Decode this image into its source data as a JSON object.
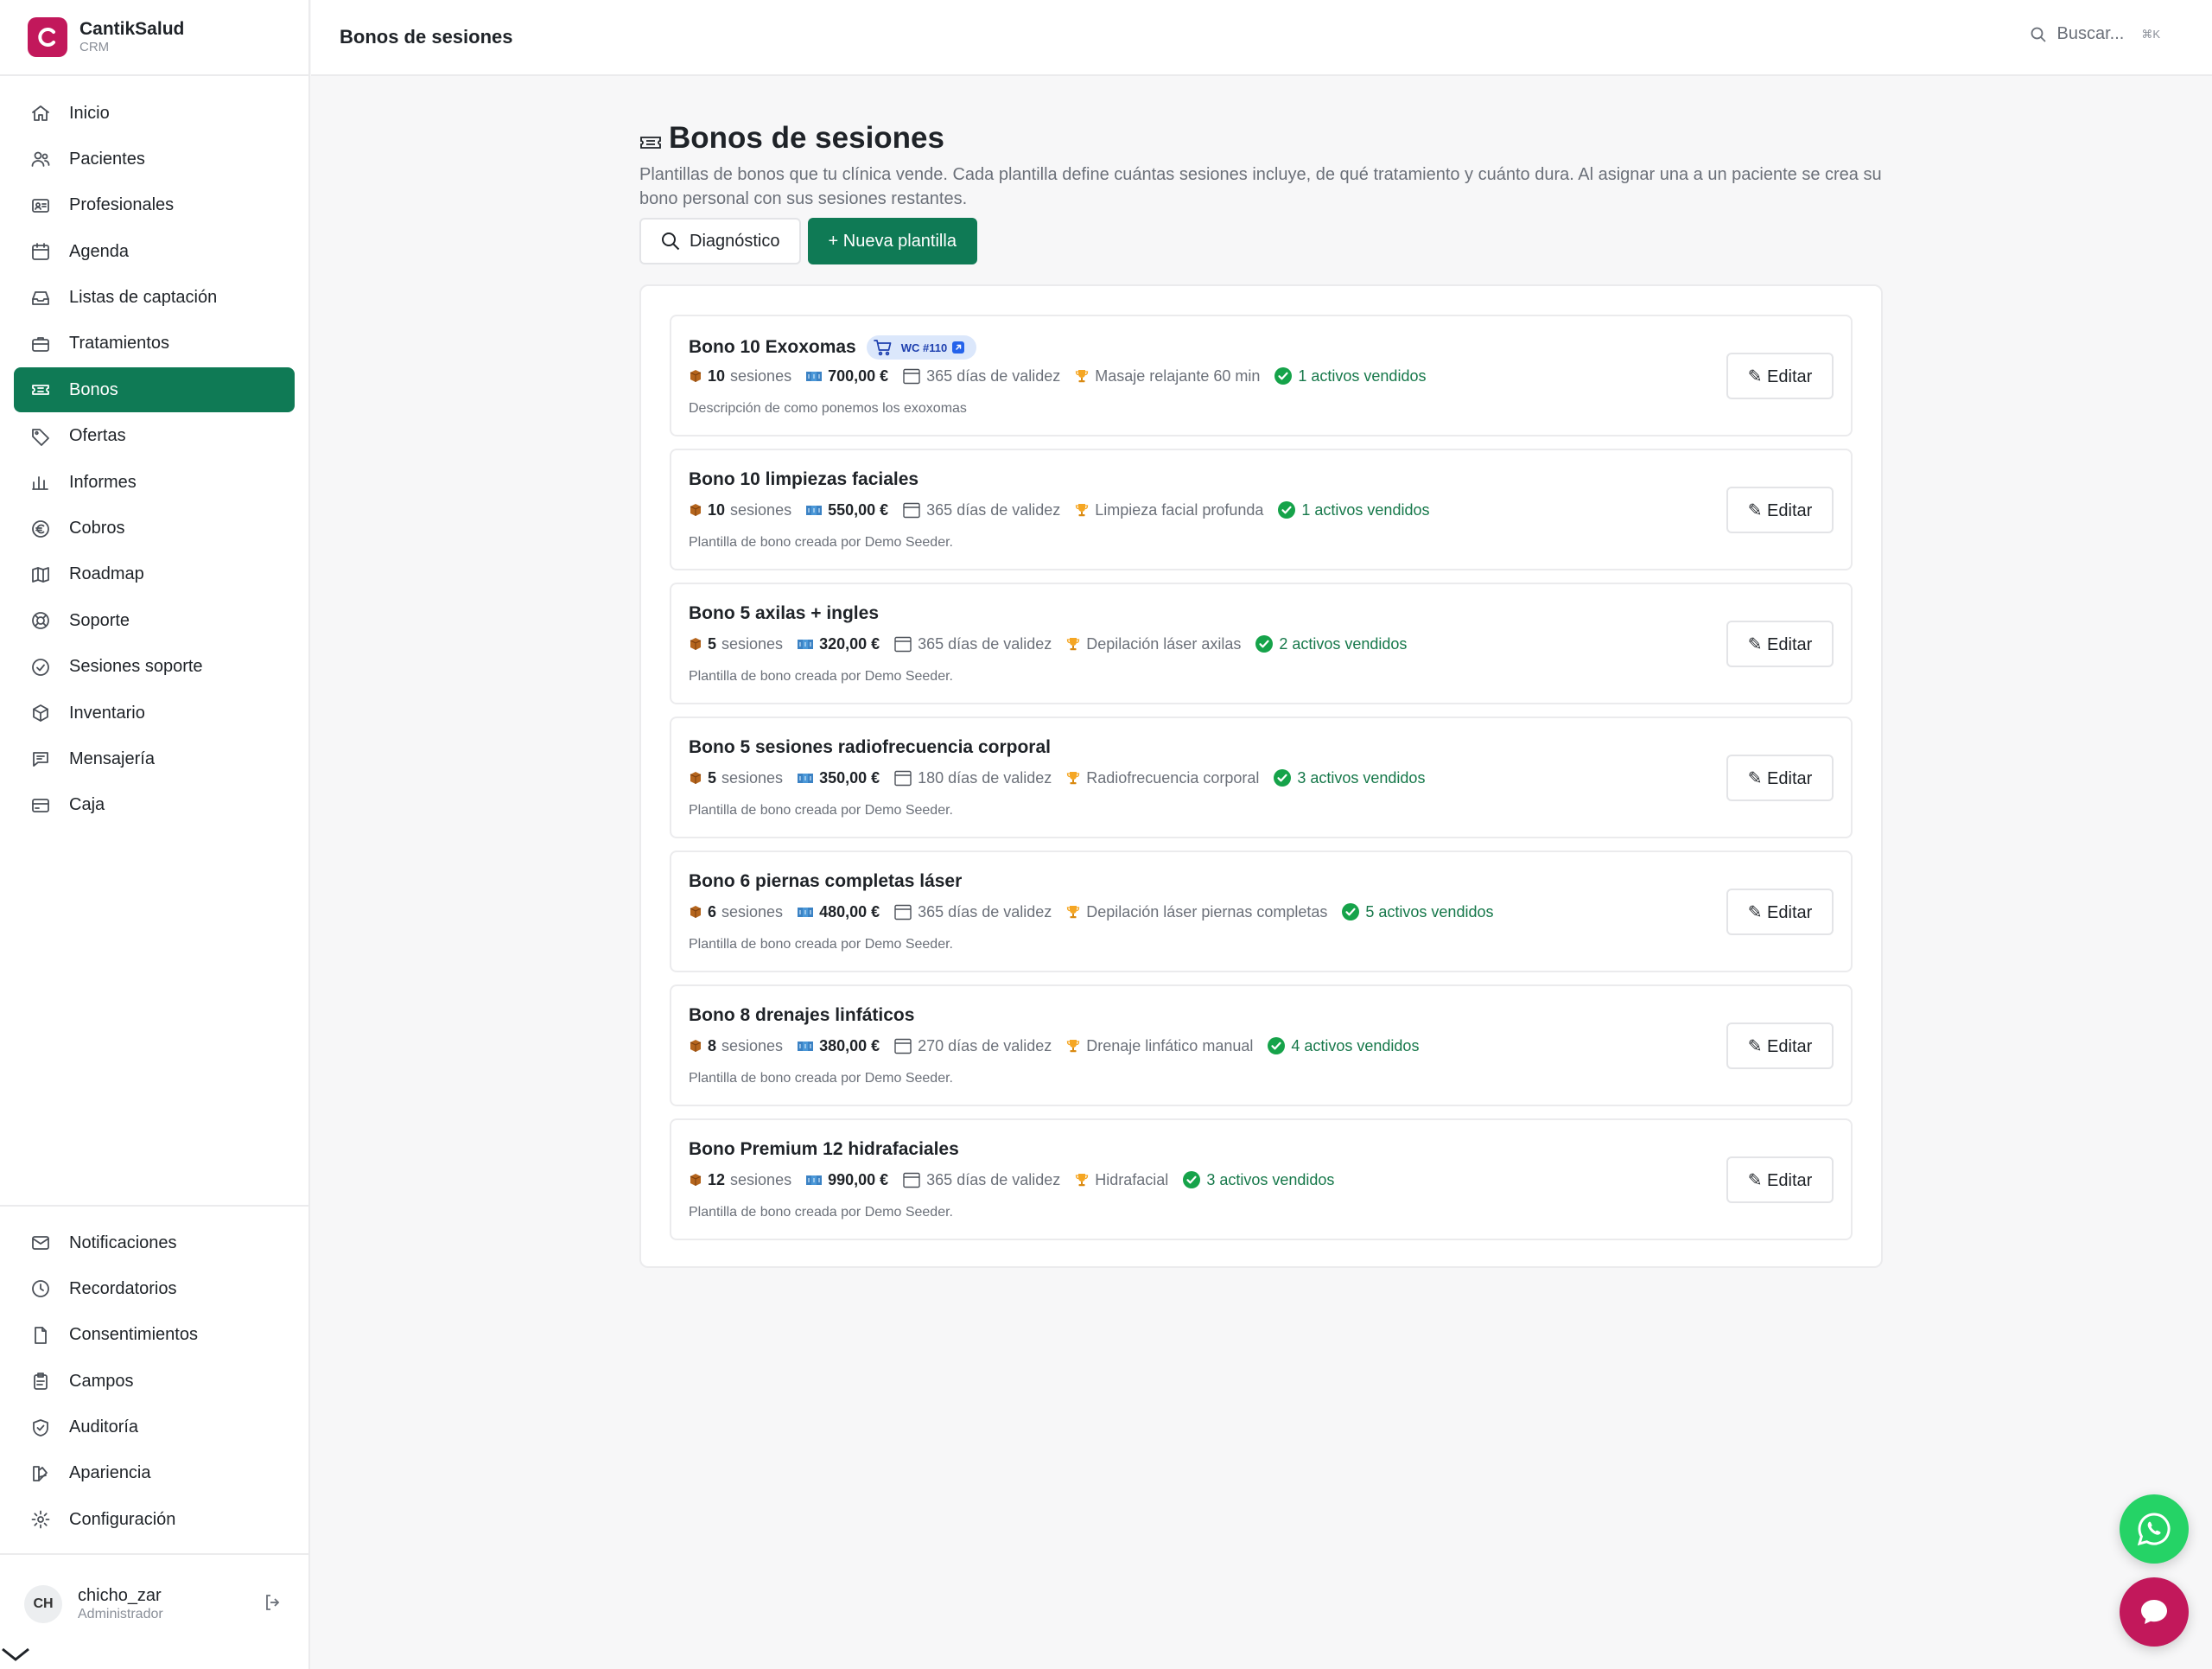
{
  "brand": {
    "name": "CantikSalud",
    "sub": "CRM"
  },
  "nav": [
    {
      "label": "Inicio",
      "icon": "home-icon"
    },
    {
      "label": "Pacientes",
      "icon": "users-icon"
    },
    {
      "label": "Profesionales",
      "icon": "id-card-icon"
    },
    {
      "label": "Agenda",
      "icon": "calendar-icon"
    },
    {
      "label": "Listas de captación",
      "icon": "inbox-icon"
    },
    {
      "label": "Tratamientos",
      "icon": "briefcase-icon"
    },
    {
      "label": "Bonos",
      "icon": "ticket-icon",
      "active": true
    },
    {
      "label": "Ofertas",
      "icon": "tag-icon"
    },
    {
      "label": "Informes",
      "icon": "bar-chart-icon"
    },
    {
      "label": "Cobros",
      "icon": "euro-icon"
    },
    {
      "label": "Roadmap",
      "icon": "map-icon"
    },
    {
      "label": "Soporte",
      "icon": "lifebuoy-icon"
    },
    {
      "label": "Sesiones soporte",
      "icon": "check-circle-icon"
    },
    {
      "label": "Inventario",
      "icon": "box-icon"
    },
    {
      "label": "Mensajería",
      "icon": "chat-icon"
    },
    {
      "label": "Caja",
      "icon": "credit-card-icon"
    }
  ],
  "nav_bottom": [
    {
      "label": "Notificaciones",
      "icon": "mail-icon"
    },
    {
      "label": "Recordatorios",
      "icon": "clock-icon"
    },
    {
      "label": "Consentimientos",
      "icon": "file-icon"
    },
    {
      "label": "Campos",
      "icon": "clipboard-icon"
    },
    {
      "label": "Auditoría",
      "icon": "shield-check-icon"
    },
    {
      "label": "Apariencia",
      "icon": "palette-icon"
    },
    {
      "label": "Configuración",
      "icon": "gear-icon"
    }
  ],
  "user": {
    "initials": "CH",
    "name": "chicho_zar",
    "role": "Administrador"
  },
  "topbar": {
    "title": "Bonos de sesiones",
    "search_placeholder": "Buscar...",
    "search_kbd": "⌘K"
  },
  "page": {
    "title": "Bonos de sesiones",
    "description": "Plantillas de bonos que tu clínica vende. Cada plantilla define cuántas sesiones incluye, de qué tratamiento y cuánto dura. Al asignar una a un paciente se crea su bono personal con sus sesiones restantes.",
    "btn_diagnostico": "Diagnóstico",
    "btn_nueva": "+ Nueva plantilla",
    "edit_label": "✎ Editar",
    "sessions_word": "sesiones"
  },
  "bonos": [
    {
      "title": "Bono 10 Exoxomas",
      "badge": "WC #110",
      "sessions": "10",
      "price": "700,00 €",
      "validity": "365 días de validez",
      "treatment": "Masaje relajante 60 min",
      "sold": "1 activos vendidos",
      "description": "Descripción de como ponemos los exoxomas"
    },
    {
      "title": "Bono 10 limpiezas faciales",
      "sessions": "10",
      "price": "550,00 €",
      "validity": "365 días de validez",
      "treatment": "Limpieza facial profunda",
      "sold": "1 activos vendidos",
      "description": "Plantilla de bono creada por Demo Seeder."
    },
    {
      "title": "Bono 5 axilas + ingles",
      "sessions": "5",
      "price": "320,00 €",
      "validity": "365 días de validez",
      "treatment": "Depilación láser axilas",
      "sold": "2 activos vendidos",
      "description": "Plantilla de bono creada por Demo Seeder."
    },
    {
      "title": "Bono 5 sesiones radiofrecuencia corporal",
      "sessions": "5",
      "price": "350,00 €",
      "validity": "180 días de validez",
      "treatment": "Radiofrecuencia corporal",
      "sold": "3 activos vendidos",
      "description": "Plantilla de bono creada por Demo Seeder."
    },
    {
      "title": "Bono 6 piernas completas láser",
      "sessions": "6",
      "price": "480,00 €",
      "validity": "365 días de validez",
      "treatment": "Depilación láser piernas completas",
      "sold": "5 activos vendidos",
      "description": "Plantilla de bono creada por Demo Seeder."
    },
    {
      "title": "Bono 8 drenajes linfáticos",
      "sessions": "8",
      "price": "380,00 €",
      "validity": "270 días de validez",
      "treatment": "Drenaje linfático manual",
      "sold": "4 activos vendidos",
      "description": "Plantilla de bono creada por Demo Seeder."
    },
    {
      "title": "Bono Premium 12 hidrafaciales",
      "sessions": "12",
      "price": "990,00 €",
      "validity": "365 días de validez",
      "treatment": "Hidrafacial",
      "sold": "3 activos vendidos",
      "description": "Plantilla de bono creada por Demo Seeder."
    }
  ],
  "colors": {
    "primary": "#0f7a55",
    "brand": "#c2185b",
    "success": "#16a34a",
    "whatsapp": "#25d366"
  }
}
